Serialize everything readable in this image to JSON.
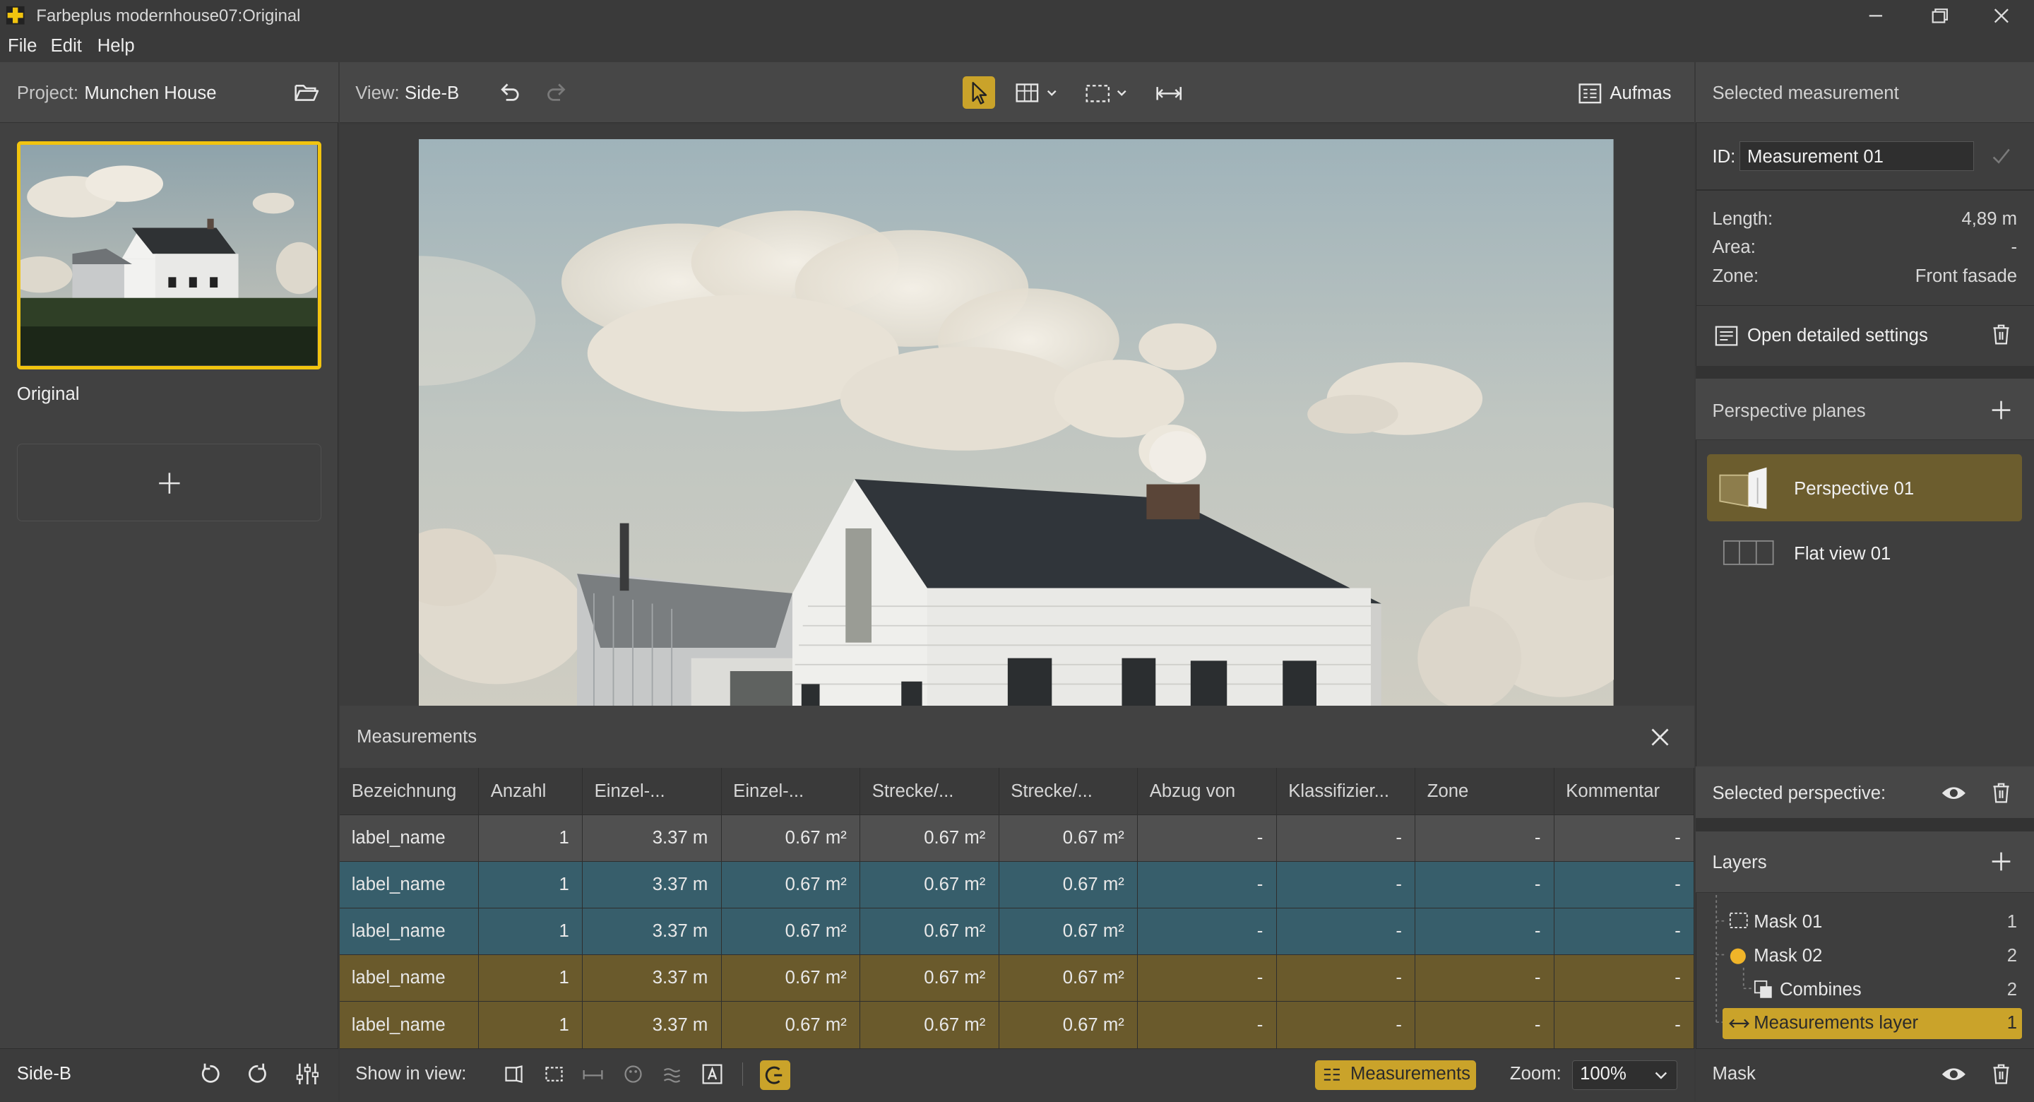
{
  "app": {
    "title": "Farbeplus modernhouse07:Original",
    "menu": [
      "File",
      "Edit",
      "Help"
    ]
  },
  "left_panel": {
    "project_label": "Project:",
    "project_name": "Munchen House",
    "thumbnail_label": "Original",
    "footer_label": "Side-B"
  },
  "toolbar": {
    "view_label": "View:",
    "view_value": "Side-B",
    "aufmas_label": "Aufmas"
  },
  "measurements": {
    "title": "Measurements",
    "columns": [
      "Bezeichnung",
      "Anzahl",
      "Einzel-...",
      "Einzel-...",
      "Strecke/...",
      "Strecke/...",
      "Abzug von",
      "Klassifizier...",
      "Zone",
      "Kommentar"
    ],
    "rows": [
      {
        "style": "gray",
        "cells": [
          "label_name",
          "1",
          "3.37 m",
          "0.67 m²",
          "0.67 m²",
          "0.67 m²",
          "-",
          "-",
          "-",
          "-"
        ]
      },
      {
        "style": "teal",
        "cells": [
          "label_name",
          "1",
          "3.37 m",
          "0.67 m²",
          "0.67 m²",
          "0.67 m²",
          "-",
          "-",
          "-",
          "-"
        ]
      },
      {
        "style": "teal",
        "cells": [
          "label_name",
          "1",
          "3.37 m",
          "0.67 m²",
          "0.67 m²",
          "0.67 m²",
          "-",
          "-",
          "-",
          "-"
        ]
      },
      {
        "style": "olive",
        "cells": [
          "label_name",
          "1",
          "3.37 m",
          "0.67 m²",
          "0.67 m²",
          "0.67 m²",
          "-",
          "-",
          "-",
          "-"
        ]
      },
      {
        "style": "olive",
        "cells": [
          "label_name",
          "1",
          "3.37 m",
          "0.67 m²",
          "0.67 m²",
          "0.67 m²",
          "-",
          "-",
          "-",
          "-"
        ]
      }
    ]
  },
  "footer": {
    "show_in_view_label": "Show in view:",
    "measurements_button": "Measurements",
    "zoom_label": "Zoom:",
    "zoom_value": "100%"
  },
  "right_panel": {
    "selected_measurement_title": "Selected measurement",
    "id_label": "ID:",
    "id_value": "Measurement 01",
    "length_label": "Length:",
    "length_value": "4,89 m",
    "area_label": "Area:",
    "area_value": "-",
    "zone_label": "Zone:",
    "zone_value": "Front fasade",
    "open_settings_label": "Open detailed settings",
    "perspective_planes_title": "Perspective planes",
    "perspectives": [
      "Perspective 01",
      "Flat view 01"
    ],
    "selected_perspective_title": "Selected perspective:",
    "layers_title": "Layers",
    "layers": [
      {
        "label": "Mask 01",
        "count": "1"
      },
      {
        "label": "Mask 02",
        "count": "2"
      },
      {
        "label": "Combines",
        "count": "2"
      },
      {
        "label": "Measurements layer",
        "count": "1"
      }
    ],
    "footer_label": "Mask"
  },
  "colors": {
    "accent": "#caa32a",
    "teal_row": "#375e6b",
    "olive_row": "#6a5a2c"
  }
}
